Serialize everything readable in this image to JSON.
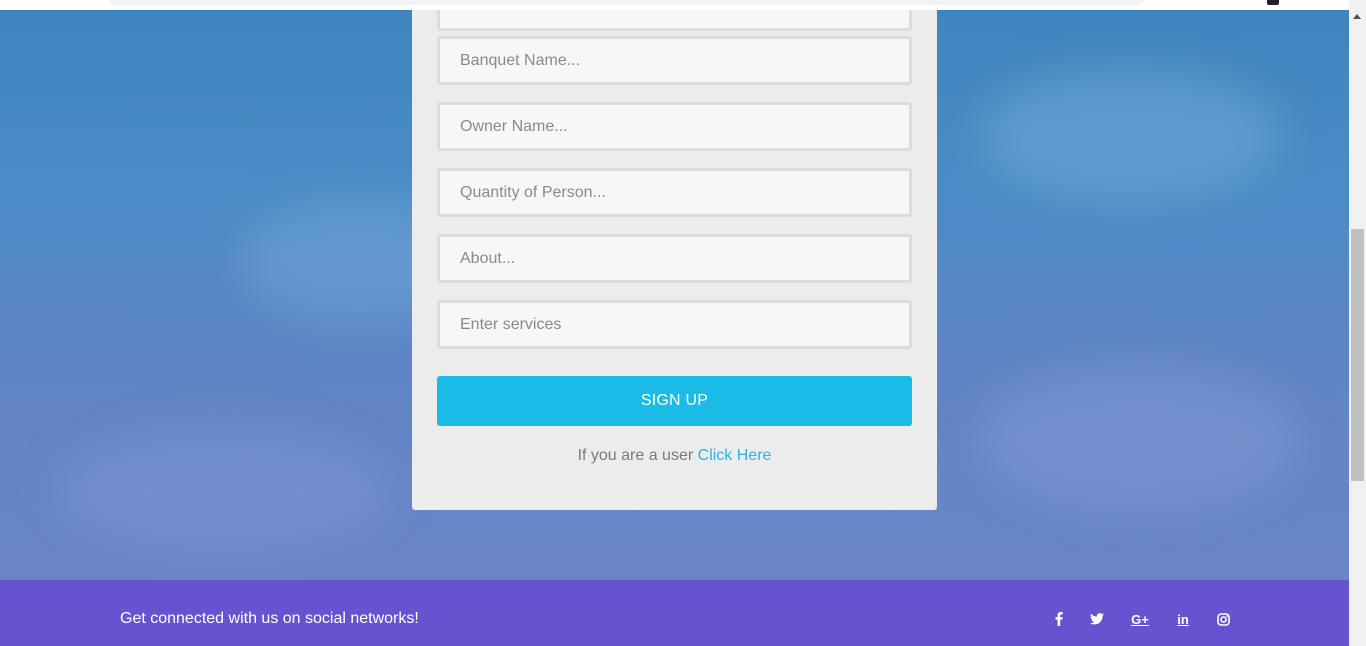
{
  "form": {
    "fields": [
      {
        "placeholder": "",
        "value": ""
      },
      {
        "placeholder": "Banquet Name...",
        "value": ""
      },
      {
        "placeholder": "Owner Name...",
        "value": ""
      },
      {
        "placeholder": "Quantity of Person...",
        "value": ""
      },
      {
        "placeholder": "About...",
        "value": ""
      },
      {
        "placeholder": "Enter services",
        "value": ""
      }
    ],
    "submit_label": "SIGN UP",
    "login_prompt": "If you are a user",
    "login_link": "Click Here"
  },
  "footer": {
    "text": "Get connected with us on social networks!",
    "social_icons": [
      "facebook-icon",
      "twitter-icon",
      "google-plus-icon",
      "linkedin-icon",
      "instagram-icon"
    ],
    "google_plus_glyph": "G+",
    "linkedin_glyph": "in"
  },
  "colors": {
    "accent": "#1bbbe8",
    "link": "#2eb4e3",
    "footer": "#6653cf",
    "card": "#ececec"
  }
}
